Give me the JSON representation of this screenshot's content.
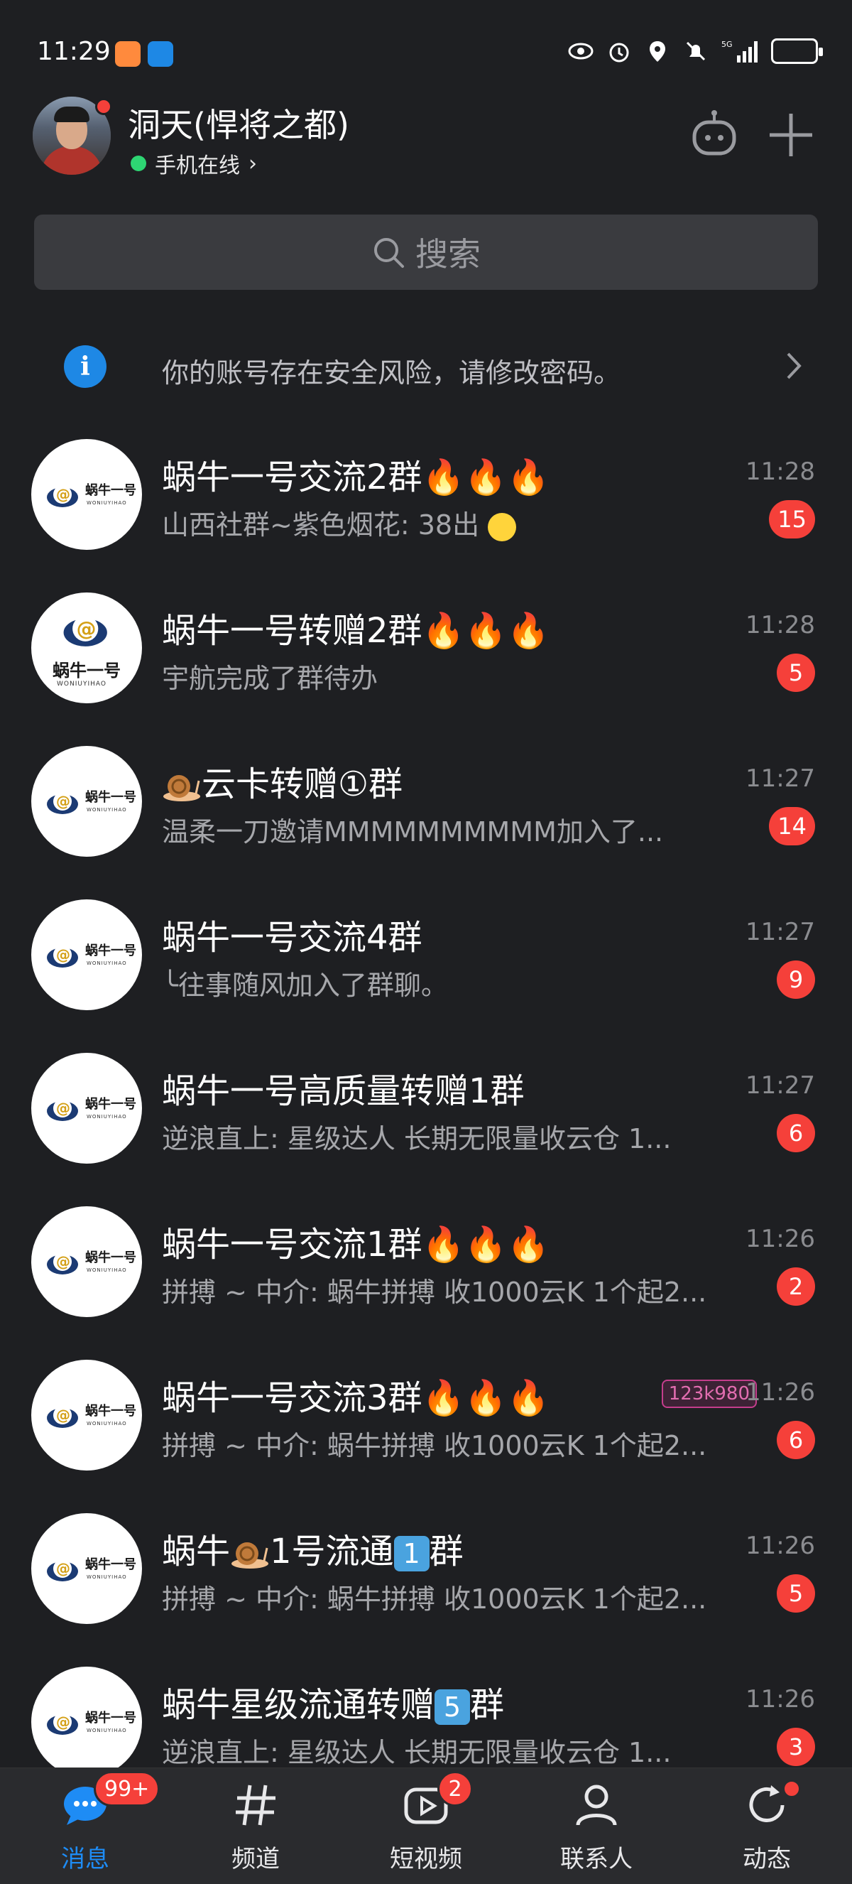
{
  "status_bar": {
    "time": "11:29",
    "network": "5G"
  },
  "header": {
    "profile_name": "洞天(悍将之都)",
    "online_status": "手机在线",
    "status_chevron": "›"
  },
  "search": {
    "placeholder": "搜索"
  },
  "security_notice": {
    "text": "你的账号存在安全风险，请修改密码。"
  },
  "chats": [
    {
      "title": "蜗牛一号交流2群",
      "title_suffix": "🔥🔥🔥",
      "preview": "山西社群~紫色烟花: 38出",
      "time": "11:28",
      "unread": "15",
      "avatar_icon": "snail-logo-icon"
    },
    {
      "title": "蜗牛一号转赠2群",
      "title_suffix": "🔥🔥🔥",
      "preview": "宇航完成了群待办",
      "time": "11:28",
      "unread": "5",
      "avatar_icon": "snail-logo-big-icon"
    },
    {
      "title": "云卡转赠①群",
      "title_prefix_icon": "snail-emoji-icon",
      "preview": "温柔一刀邀请MMMMMMMMMM加入了...",
      "time": "11:27",
      "unread": "14",
      "avatar_icon": "snail-logo-icon"
    },
    {
      "title": "蜗牛一号交流4群",
      "preview": "╰往事随风加入了群聊。",
      "time": "11:27",
      "unread": "9",
      "avatar_icon": "snail-logo-icon"
    },
    {
      "title": "蜗牛一号高质量转赠1群",
      "preview": "逆浪直上: 星级达人 长期无限量收云仓 1...",
      "time": "11:27",
      "unread": "6",
      "avatar_icon": "snail-logo-icon"
    },
    {
      "title": "蜗牛一号交流1群",
      "title_suffix": "🔥🔥🔥",
      "preview": "拼搏 ~ 中介: 蜗牛拼搏 收1000云K 1个起2...",
      "time": "11:26",
      "unread": "2",
      "avatar_icon": "snail-logo-icon"
    },
    {
      "title": "蜗牛一号交流3群",
      "title_suffix": "🔥🔥🔥",
      "preview": "拼搏 ~ 中介: 蜗牛拼搏 收1000云K 1个起2...",
      "time": "11:26",
      "unread": "6",
      "avatar_icon": "snail-logo-icon",
      "watermark": "123k980"
    },
    {
      "title_part1": "蜗牛",
      "title_part2": "1号流通",
      "keycap": "1",
      "title_part3": "群",
      "preview": "拼搏 ~ 中介: 蜗牛拼搏 收1000云K 1个起2...",
      "time": "11:26",
      "unread": "5",
      "avatar_icon": "snail-logo-icon"
    },
    {
      "title_part1": "蜗牛星级流通转赠",
      "keycap": "5",
      "title_part3": "群",
      "preview": "逆浪直上: 星级达人 长期无限量收云仓 1...",
      "time": "11:26",
      "unread": "3",
      "avatar_icon": "snail-logo-icon"
    }
  ],
  "logo": {
    "text": "蜗牛一号",
    "sub": "WONIUYIHAO"
  },
  "bottom_nav": [
    {
      "label": "消息",
      "icon": "message-icon",
      "badge": "99+",
      "active": true
    },
    {
      "label": "频道",
      "icon": "channel-hash-icon"
    },
    {
      "label": "短视频",
      "icon": "video-icon",
      "badge": "2"
    },
    {
      "label": "联系人",
      "icon": "contacts-icon"
    },
    {
      "label": "动态",
      "icon": "moments-icon",
      "dot": true
    }
  ],
  "colors": {
    "background": "#1e1f22",
    "badge": "#f5403a",
    "accent": "#1e8cf5",
    "online": "#2ed573"
  }
}
